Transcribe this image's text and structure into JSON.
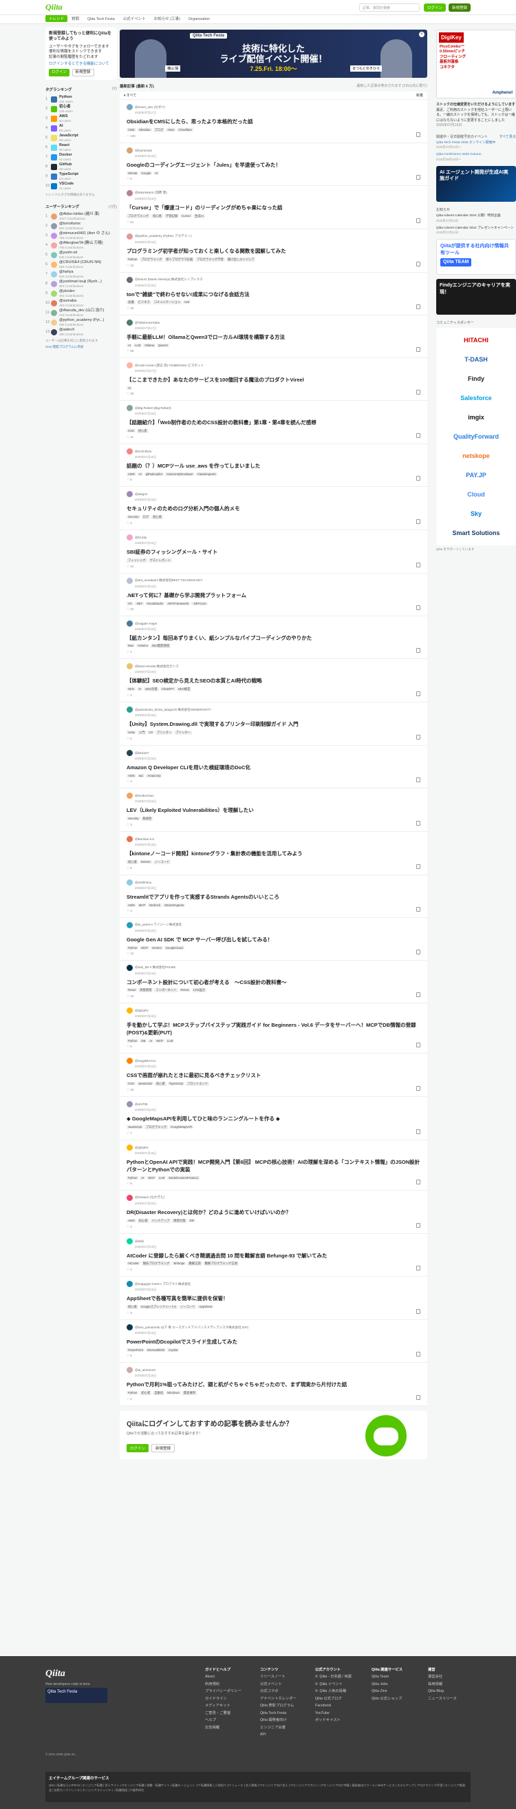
{
  "header": {
    "logo": "Qiita",
    "search_placeholder": "記事、質問を検索",
    "login": "ログイン",
    "signup": "新規登録"
  },
  "nav": {
    "tabs": [
      "トレンド",
      "質問",
      "Qiita Tech Festa",
      "公式イベント",
      "お知らせ (工事)",
      "Organization"
    ]
  },
  "welcome": {
    "title": "新規登録してもっと便利にQiitaを使ってみよう",
    "lines": [
      "ユーザーやタグをフォローできます",
      "便利な情報をストックできます",
      "記事の閲覧履歴をたどれます"
    ],
    "link": "ログインするとできる機能について",
    "login_btn": "ログイン",
    "signup_btn": "新規登録"
  },
  "tag_ranking": {
    "title": "タグランキング",
    "sub": "(X)",
    "items": [
      {
        "name": "Python",
        "count": "144 users",
        "color": "#3572a5"
      },
      {
        "name": "初心者",
        "count": "135 users",
        "color": "#55c500"
      },
      {
        "name": "AWS",
        "count": "94 users",
        "color": "#ff9900"
      },
      {
        "name": "AI",
        "count": "86 users",
        "color": "#7b61ff"
      },
      {
        "name": "JavaScript",
        "count": "69 users",
        "color": "#f1e05a"
      },
      {
        "name": "React",
        "count": "60 users",
        "color": "#61dafb"
      },
      {
        "name": "Docker",
        "count": "52 users",
        "color": "#2496ed"
      },
      {
        "name": "GitHub",
        "count": "49 users",
        "color": "#24292e"
      },
      {
        "name": "TypeScript",
        "count": "43 users",
        "color": "#3178c6"
      },
      {
        "name": "VSCode",
        "count": "41 users",
        "color": "#007acc"
      }
    ],
    "footer": "トレンドにタグの情報はありません"
  },
  "user_ranking": {
    "title": "ユーザーランキング",
    "sub": "(7月)",
    "items": [
      {
        "name": "@Akiko-Ishiko (越川 凜)",
        "score": "1027 Contributions",
        "color": "#e9a16b"
      },
      {
        "name": "@tomofumix",
        "score": "991 Contributions",
        "color": "#8d99ae"
      },
      {
        "name": "@mimurun0401 (Ann の さん)",
        "score": "755 Contributions",
        "color": "#c28ef2"
      },
      {
        "name": "@AfterglowTA (勝山 万穂)",
        "score": "700 Contributions",
        "color": "#f6a5a5"
      },
      {
        "name": "@yoshi-sd",
        "score": "645 Contributions",
        "color": "#7ec7b8"
      },
      {
        "name": "@CRUISE4 (CRUIS NN)",
        "score": "583 Contributions",
        "color": "#ffb86b"
      },
      {
        "name": "@hahya",
        "score": "525 Contributions",
        "color": "#9ad0ec"
      },
      {
        "name": "@yoshinari-tsuji (Ryoh...)",
        "score": "503 Contributions",
        "color": "#b7a0d8"
      },
      {
        "name": "@ykzdev",
        "score": "491 Contributions",
        "color": "#a4d96c"
      },
      {
        "name": "@sumaba",
        "score": "453 Contributions",
        "color": "#e07a5f"
      },
      {
        "name": "@Ataruda_dev (山口 浩介)",
        "score": "415 Contributions",
        "color": "#81b29a"
      },
      {
        "name": "@python_academy (Pyt...)",
        "score": "399 Contributions",
        "color": "#f2cc8f"
      },
      {
        "name": "@aidevX",
        "score": "380 Contributions",
        "color": "#3d405b"
      }
    ],
    "footer": "ユーザーは記事を同じに更新されます",
    "link": "Give 開発プログラムに参加"
  },
  "banner": {
    "tag": "Qiita Tech Festa",
    "line1": "技術に特化した",
    "line2": "ライブ配信イベント開催！",
    "date": "7.25.Fri. 18:00〜",
    "name1": "横山 陽",
    "name2": "まつもとゆきひろ"
  },
  "feed": {
    "title": "最新記事 (最新 6 万)",
    "note": "最新した記事が表示されます (1日以内に限り)",
    "filter": "すべて",
    "sort": "新着"
  },
  "articles": [
    {
      "author": "@neuro_dev (なぜ!?)",
      "date": "2025年07月17日",
      "title": "ObsidianをCMSにしたら、思ったより本格的だった話",
      "tags": [
        "CMS",
        "Obsidian",
        "ブログ",
        "Astro",
        "Cloudflare"
      ],
      "likes": "106",
      "color": "#7aa6c2"
    },
    {
      "author": "@Kazumaio",
      "date": "2025年07月16日",
      "title": "Googleのコーディングエージェント「Jules」を早速使ってみた！",
      "tags": [
        "GitHub",
        "Google",
        "AI"
      ],
      "likes": "9",
      "color": "#d4a373"
    },
    {
      "author": "@tokorokano (羽原 塁)",
      "date": "2025年07月16日",
      "title": "「Cursor」で「爆速コード」のリーディングがめちゃ楽になった話",
      "tags": [
        "プログラミング",
        "初心者",
        "学習記録",
        "Cursor",
        "生成AI"
      ],
      "likes": "91",
      "color": "#b5838d"
    },
    {
      "author": "@python_academy (Python アカデミー)",
      "date": "2025年07月15日",
      "title": "プログラミング初学者が知っておくと楽しくなる関数を図解してみた",
      "tags": [
        "Python",
        "プログラミング",
        "新人プログラマ応援",
        "プログラミング学習",
        "駆け出しエンジニア"
      ],
      "likes": "42",
      "color": "#e5989b"
    },
    {
      "author": "@haruO (Naoto Seimiya) 株式会社シンプレクス",
      "date": "2025年07月16日",
      "title": "tonで\"雑談\"で終わらせない!成果につなげる会話方法",
      "tags": [
        "会議",
        "ビジネス",
        "コミュニケーション",
        "tool"
      ],
      "likes": "20",
      "color": "#6d6875"
    },
    {
      "author": "@Takamura-kabu",
      "date": "2025年07月17日",
      "title": "手軽に最新LLM！OllamaとQwen3でローカルAI環境を構築する方法",
      "tags": [
        "AI",
        "LLM",
        "Ollama",
        "Qwen3"
      ],
      "likes": "68",
      "color": "#52796f"
    },
    {
      "author": "@code-ocean (渡辺 亮) ChatBizNow! ビズボット",
      "date": "2025年07月17日",
      "title": "【ここまできたか】あなたのサービスを100億回する魔法のプロダクトVireel",
      "tags": [
        "AI"
      ],
      "likes": "28",
      "color": "#ffb4a2"
    },
    {
      "author": "@Big-Robert (Big Robert)",
      "date": "2025年07月16日",
      "title": "【話題紹介】「Web制作者のためのCSS設計の教科書」第1章・第4章を読んだ感想",
      "tags": [
        "CSS",
        "初心者"
      ],
      "likes": "11",
      "color": "#84a59d"
    },
    {
      "author": "@mch4hizu",
      "date": "2025年07月16日",
      "title": "話題の（？）MCPツール use_aws を作ってしまいました",
      "tags": [
        "AWS",
        "AI",
        "githubcopilot",
        "AmazonQDeveloper",
        "ClaudeAgents"
      ],
      "likes": "8",
      "color": "#f28482"
    },
    {
      "author": "@akigon",
      "date": "2025年07月16日",
      "title": "セキュリティのためのログ分析入門の個人的メモ",
      "tags": [
        "Security",
        "ログ",
        "初心者"
      ],
      "likes": "4",
      "color": "#9c89b8"
    },
    {
      "author": "@h1n9y",
      "date": "2025年07月16日",
      "title": "SBI証券のフィッシングメール・サイト",
      "tags": [
        "フィッシング",
        "ゲストレポート"
      ],
      "likes": "10",
      "color": "#f0a6ca"
    },
    {
      "author": "@ant_murakami 株式会社BEST TECHNOLOGY",
      "date": "2025年07月16日",
      "title": ".NETって何に？基礎から学ぶ開発プラットフォーム",
      "tags": [
        "C#",
        ".NET",
        "VisualStudio",
        ".NETFramework",
        ".NETCore"
      ],
      "likes": "22",
      "color": "#b8bedd"
    },
    {
      "author": "@nagatA-maps",
      "date": "2025年07月16日",
      "title": "【紙カンタン】毎回あずりまくい、紙シンプルなパイプコーディングのやりかた",
      "tags": [
        "Mac",
        "Arduino",
        "Mini開発環境"
      ],
      "likes": "1",
      "color": "#457b9d"
    },
    {
      "author": "@kane-remata 株式会社ゼンス",
      "date": "2025年07月16日",
      "title": "【体験記】SEO検定から見えたSEOの本質とAI時代の戦略",
      "tags": [
        "SEO",
        "AI",
        "SEO対策",
        "ChatGPT",
        "SEO検定"
      ],
      "likes": "4",
      "color": "#e9c46a"
    },
    {
      "author": "@yamamoto_hiroto_taniguchi 株式会社GENEROSITY",
      "date": "2025年07月16日",
      "title": "【Unity】System.Drawing.dll で実現するプリンター印刷制御ガイド 入門",
      "tags": [
        "Unity",
        "入門",
        "C#",
        "プリンター",
        "プリンター"
      ],
      "likes": "5",
      "color": "#2a9d8f"
    },
    {
      "author": "@kei1107",
      "date": "2025年07月16日",
      "title": "Amazon Q Developer CLIを用いた検証環境のDoC化",
      "tags": [
        "AWS",
        "IaC",
        "AmazonQ"
      ],
      "likes": "4",
      "color": "#264653"
    },
    {
      "author": "@GeikoChan",
      "date": "2025年07月16日",
      "title": "LEV（Likely Exploited Vulnerabilities）を理解したい",
      "tags": [
        "Security",
        "脆弱性"
      ],
      "likes": "3",
      "color": "#f4a261"
    },
    {
      "author": "@Bonhan.k.5",
      "date": "2025年07月16日",
      "title": "【kintoneノーコード開発】kintoneグラフ・集計表の機能を活用してみよう",
      "tags": [
        "初心者",
        "kintone",
        "ノーコード"
      ],
      "likes": "6",
      "color": "#e76f51"
    },
    {
      "author": "@minfiminu",
      "date": "2025年07月16日",
      "title": "Streamlitでアプリを作って実感するStrands Agentsのいいところ",
      "tags": [
        "AWS",
        "MCP",
        "Bedrock",
        "StrandsAgents"
      ],
      "likes": "3",
      "color": "#8ecae6"
    },
    {
      "author": "@ai_yamo-n アイジーン株式会社",
      "date": "2025年07月16日",
      "title": "Google Gen AI SDK で MCP サーバー呼び出しを試してみる！",
      "tags": [
        "Python",
        "MCP",
        "Gemini",
        "GoogleCloud"
      ],
      "likes": "12",
      "color": "#219ebc"
    },
    {
      "author": "@suit_2D-n 株式会社PALMS",
      "date": "2025年07月16日",
      "title": "コンポーネント設計について初心者が考える　〜CSS設計の教科書〜",
      "tags": [
        "React",
        "状態管理",
        "コンポーネント",
        "Remix",
        "CSS設計"
      ],
      "likes": "15",
      "color": "#023047"
    },
    {
      "author": "@QiitaPe",
      "date": "2025年07月16日",
      "title": "手を動かして学ぶ！MCPステップバイステップ実践ガイド for Beginners - Vol.6 データをサーバーへ！MCPでDB情報の登録(POST)&更新(PUT)",
      "tags": [
        "Python",
        "DB",
        "AI",
        "MCP",
        "LLM"
      ],
      "likes": "5",
      "color": "#ffb703"
    },
    {
      "author": "@SugaMAAUI",
      "date": "2025年07月16日",
      "title": "CSSで画面が崩れたときに最初に見るべきチェックリスト",
      "tags": [
        "CSS",
        "JavaScript",
        "初心者",
        "TypeScript",
        "フロントエンド"
      ],
      "likes": "18",
      "color": "#fb8500"
    },
    {
      "author": "@ohi705",
      "date": "2025年07月16日",
      "title": "◆ GoogleMapsAPIを利用してひと味のランニングルートを作る ◆",
      "tags": [
        "JavaScript",
        "プログラミング",
        "GoogleMapsAPI"
      ],
      "likes": "7",
      "color": "#8d99ae"
    },
    {
      "author": "@QiitaPe",
      "date": "2025年07月16日",
      "title": "PythonとOpenAI APIで実践！MCP開発入門【第6回】 MCPの核心技術！AIの理解を深める「コンテキスト情報」のJSON設計パターンとPythonでの実装",
      "tags": [
        "Python",
        "AI",
        "MCP",
        "LLM",
        "ModelContextProtocol"
      ],
      "likes": "6",
      "color": "#ffb703"
    },
    {
      "author": "@miwaon (なかぎた)",
      "date": "2025年07月16日",
      "title": "DR(Disaster Recovery)とは何か？どのように進めていけばいいのか？",
      "tags": [
        "AWS",
        "初心者",
        "バックアップ",
        "障害対策",
        "DR"
      ],
      "likes": "3",
      "color": "#ef476f"
    },
    {
      "author": "@tekk",
      "date": "2025年07月16日",
      "title": "AtCoder に登録したら解くべき精選過去問 10 問を難解言語 Befunge-93 で解いてみた",
      "tags": [
        "AtCoder",
        "競技プログラミング",
        "Befunge",
        "難解言語",
        "難解プログラミング言語"
      ],
      "likes": "4",
      "color": "#06d6a0"
    },
    {
      "author": "@mappyjer-inest-n プロアクト株式会社",
      "date": "2025年07月16日",
      "title": "AppSheetで各種写真を簡単に提供を保管！",
      "tags": [
        "初心者",
        "GoogleスプレッドシートS",
        "ノーコード",
        "AppSheet"
      ],
      "likes": "3",
      "color": "#118ab2"
    },
    {
      "author": "@toru_yamamoto 山下 幸 エースグッドアドバンスドディアジスタ株式会社 DXC",
      "date": "2025年07月16日",
      "title": "PowerPointのDcopilotでスライド生成してみた",
      "tags": [
        "PowerPoint",
        "MicrosoftEdit",
        "Copilot"
      ],
      "likes": "5",
      "color": "#073b4c"
    },
    {
      "author": "@ai_aimmonX",
      "date": "2025年07月16日",
      "title": "Pythonで月利1%狙ってみたけど、頭と机がぐちゃぐちゃだったので、まず現実から片付けた話",
      "tags": [
        "Python",
        "初心者",
        "自動化",
        "Windows",
        "資産運用"
      ],
      "likes": "2",
      "color": "#c9ada7"
    }
  ],
  "cta": {
    "title": "Qiitaにログインしておすすめの記事を読みませんか？",
    "sub": "Qiitaでの活動に合っておすすめ記事を届けます！",
    "login": "ログイン",
    "signup": "新規登録"
  },
  "right": {
    "digikey_title": "DigiKey",
    "digikey_lines": [
      "PicoCombo™",
      "0.50mmピッチ",
      "フローティング",
      "基板対基板",
      "コネクタ"
    ],
    "digikey_maker": "Amphenol",
    "note1": "ストックの仕様変更をいただけるようにしています",
    "note1_body": "最近、ご利用のストックを他社ユーザーに上限いる。一緒のストックを保持しても、ストックは一緒にはならないように変更することにしました",
    "note1_date": "2025年07月16日",
    "events_head": "開催中・近日開催予定のイベント",
    "events_more": "すべて見る",
    "events": [
      {
        "title": "Qiita Tech Festa 2025 オンライン開催中",
        "date": "2025年07月01日〜"
      },
      {
        "title": "Qiita Conference 2025 Autumn",
        "date": "2025年09月16日〜"
      }
    ],
    "sq1_title": "AI エージェント開発が生成AI実施ガイド",
    "notices_head": "お知らせ",
    "notices": [
      {
        "title": "Qiita Advent Calendar 2024 公開！特別企画",
        "date": "2025年07月01日"
      },
      {
        "title": "Qiita Advent Calendar 2024 プレゼントキャンペーン",
        "date": "2025年07月01日"
      }
    ],
    "sq2_title": "Qiitaが提供する社内向け情報共有ツール",
    "sq2_sub": "Qiita TEAM",
    "sq3_title": "Findyエンジニアのキャリアを実現！",
    "sponsors_head": "コミュニティスポンサー",
    "sponsors": [
      "HITACHI",
      "T-DASH",
      "Findy",
      "Salesforce",
      "imgix",
      "QualityForward",
      "netskope",
      "PAY.JP",
      "Cloud",
      "Sky",
      "Smart Solutions"
    ],
    "sponsors_note": "Qiita をサポートしています"
  },
  "footer": {
    "logo": "Qiita",
    "tagline": "How developers code is here.",
    "banner": "Qiita Tech Festa",
    "columns": [
      {
        "title": "ガイドとヘルプ",
        "items": [
          "About",
          "利用規約",
          "プライバシーポリシー",
          "ガイドライン",
          "メディアキット",
          "ご意見・ご要望",
          "ヘルプ",
          "広告掲載"
        ]
      },
      {
        "title": "コンテンツ",
        "items": [
          "リリースノート",
          "公式イベント",
          "公式コラボ",
          "アドベントカレンダー",
          "Qiita 表彰プログラム",
          "Qiita Tech Festa",
          "Qiita 開発者向け",
          "エンジニア白書",
          "API"
        ]
      },
      {
        "title": "公式アカウント",
        "items": [
          "X: Qiita - 日本語 / 英語",
          "X: Qiita イベント",
          "X: Qiita 人気の投稿",
          "Qiita 公式ブログ",
          "Facebook",
          "YouTube",
          "ポッドキャスト"
        ]
      },
      {
        "title": "Qiita 関連サービス",
        "items": [
          "Qiita Team",
          "Qiita Jobs",
          "Qiita Zine",
          "Qiita 公式ショップ"
        ]
      },
      {
        "title": "運営",
        "items": [
          "運営会社",
          "採用情報",
          "Qiita Blog",
          "ニュースリリース"
        ]
      }
    ],
    "copyright": "© 2011-2025 Qiita Inc.",
    "bottom_title": "エイチームグループ関連のサービス",
    "bottom_links": "Qiita | 転職ならLAPRAS | エンジニア転職 | 求人サイト | ITエンジニア転職 | 就職・転職サイト | 転職エージェント | IT 転職情報 | 人材紹介 | IT ニュース | 求人情報 | ITエンジニア向け求人 | ITエンジニアマガジン | ITエンジニア向け特集 | 開発者向けツール | Webサービス | スキルアップ | プログラミング学習 | エンジニア勉強会 | 技術カンファレンス | エンジニアコミュニティ | 転職相談 | IT業界研究"
  }
}
